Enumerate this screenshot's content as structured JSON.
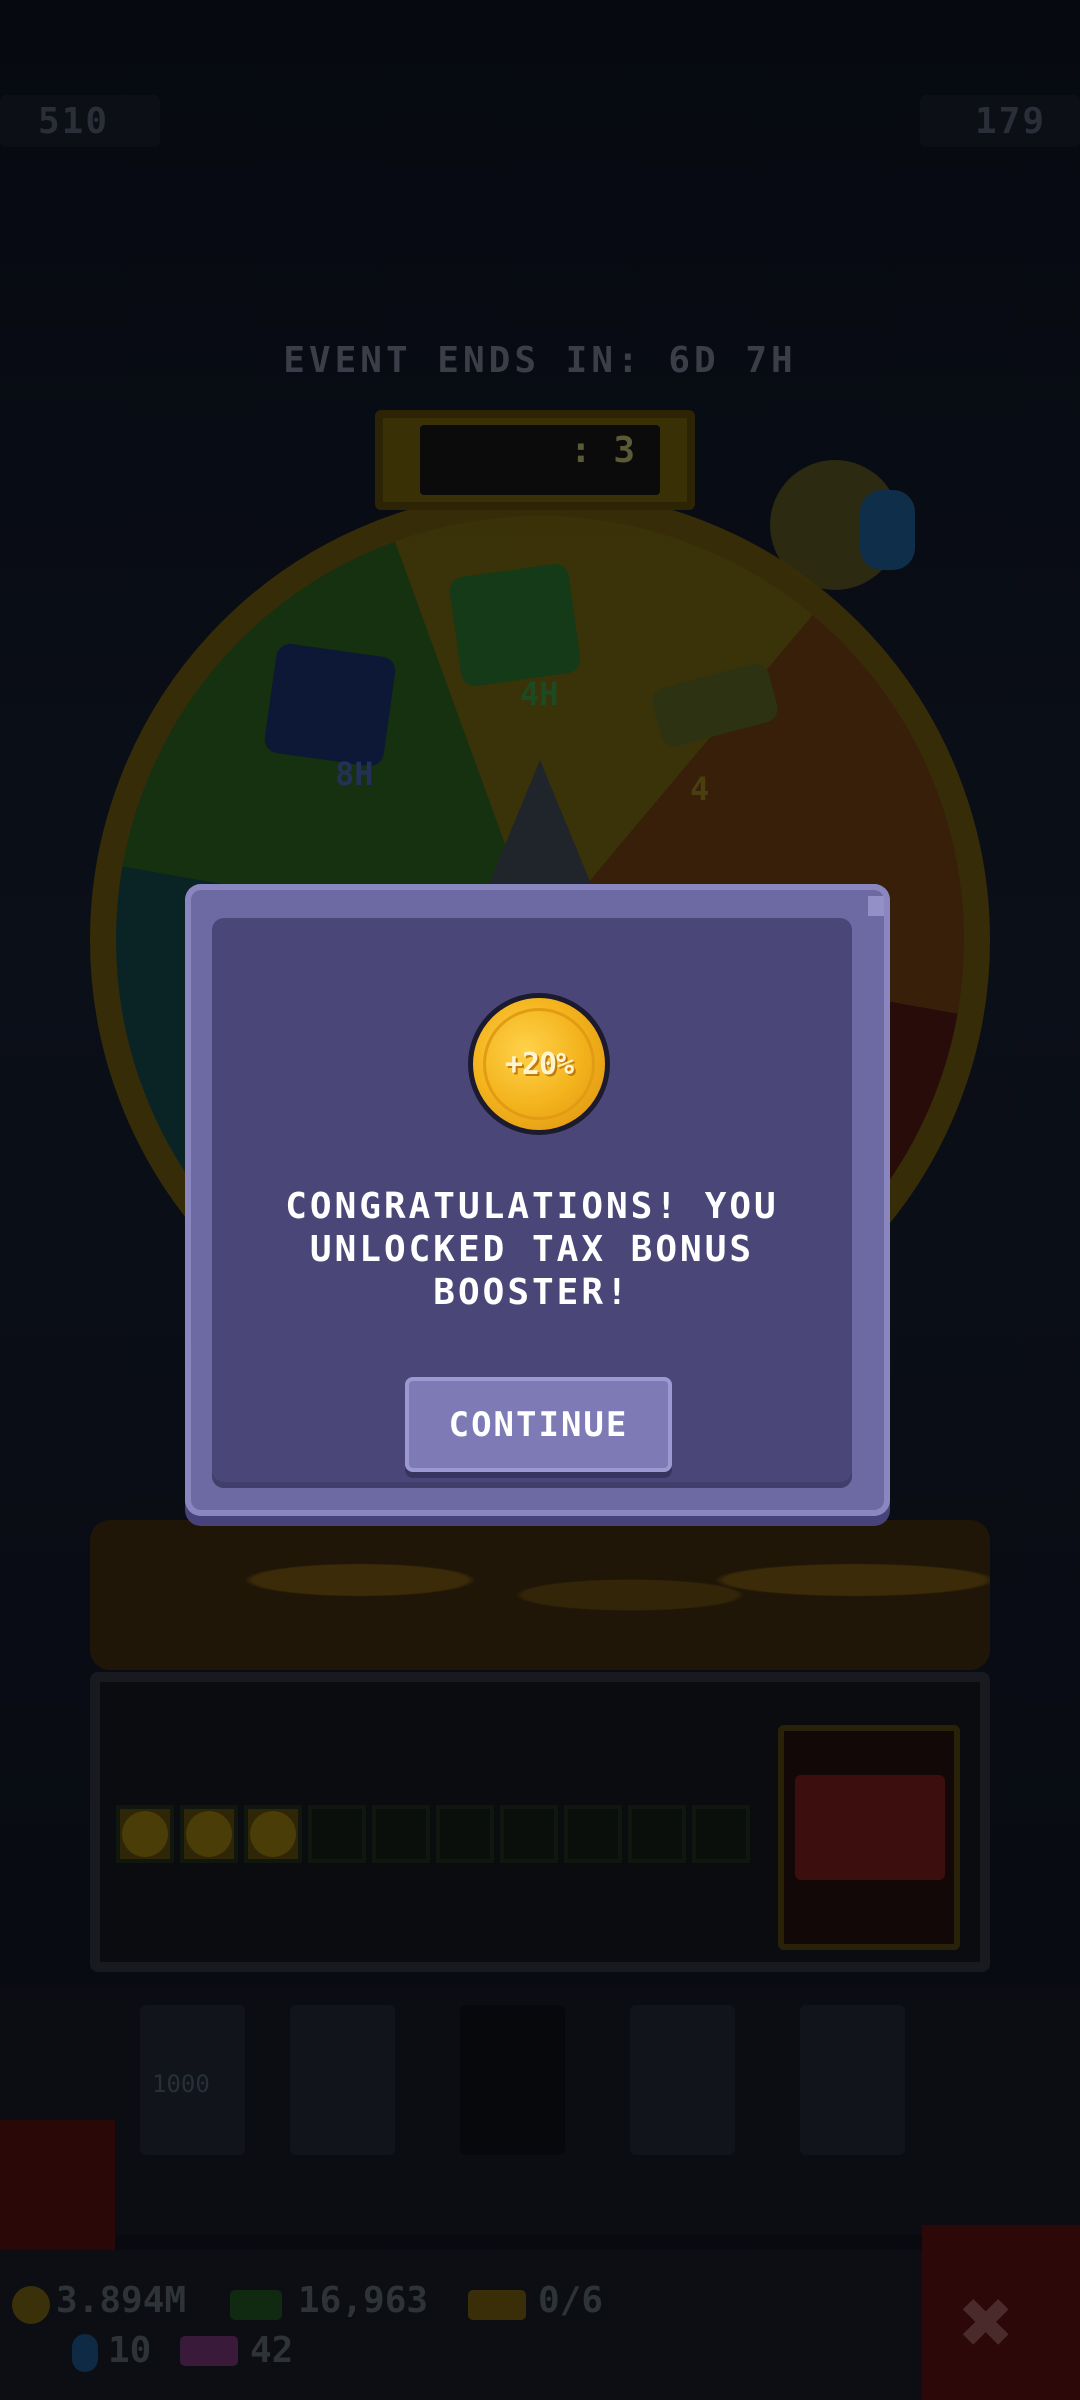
{
  "hud": {
    "left_value": "510",
    "right_value": "179"
  },
  "event": {
    "countdown": "EVENT ENDS IN: 6D 7H"
  },
  "wheel": {
    "spin_count": ": 3",
    "item_labels": [
      "8H",
      "4H",
      "4"
    ]
  },
  "shop": {
    "price_label": "1000"
  },
  "bottom_stats": {
    "coins": "3.894M",
    "cash": "16,963",
    "tickets": "0/6",
    "gems": "10",
    "level": "42"
  },
  "dialog": {
    "booster_badge": "+20%",
    "message": "CONGRATULATIONS! YOU UNLOCKED TAX BONUS BOOSTER!",
    "continue_label": "CONTINUE"
  },
  "colors": {
    "dialog_frame": "#6d6aa3",
    "dialog_body": "#4a4778",
    "button": "#7d7ab5",
    "coin": "#f3b31c"
  }
}
